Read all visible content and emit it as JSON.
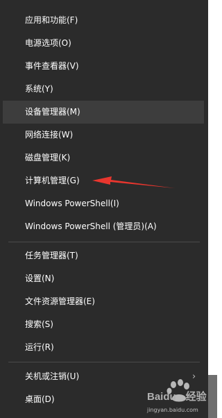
{
  "menu": {
    "items": [
      {
        "label": "应用和功能(F)"
      },
      {
        "label": "电源选项(O)"
      },
      {
        "label": "事件查看器(V)"
      },
      {
        "label": "系统(Y)"
      },
      {
        "label": "设备管理器(M)"
      },
      {
        "label": "网络连接(W)"
      },
      {
        "label": "磁盘管理(K)"
      },
      {
        "label": "计算机管理(G)"
      },
      {
        "label": "Windows PowerShell(I)"
      },
      {
        "label": "Windows PowerShell (管理员)(A)"
      },
      {
        "label": "任务管理器(T)"
      },
      {
        "label": "设置(N)"
      },
      {
        "label": "文件资源管理器(E)"
      },
      {
        "label": "搜索(S)"
      },
      {
        "label": "运行(R)"
      },
      {
        "label": "关机或注销(U)"
      },
      {
        "label": "桌面(D)"
      }
    ],
    "hovered_item": "设备管理器(M)",
    "submenu_chevron": "›"
  },
  "annotation": {
    "arrow_color": "#e8362e",
    "points_to": "计算机管理(G)"
  },
  "watermark": {
    "brand": "Baidu",
    "brand_suffix": "经验",
    "url": "jingyan.baidu.com"
  },
  "colors": {
    "menu_background": "#2b2b2b",
    "hover_background": "#3d3d3d",
    "text": "#ffffff"
  }
}
